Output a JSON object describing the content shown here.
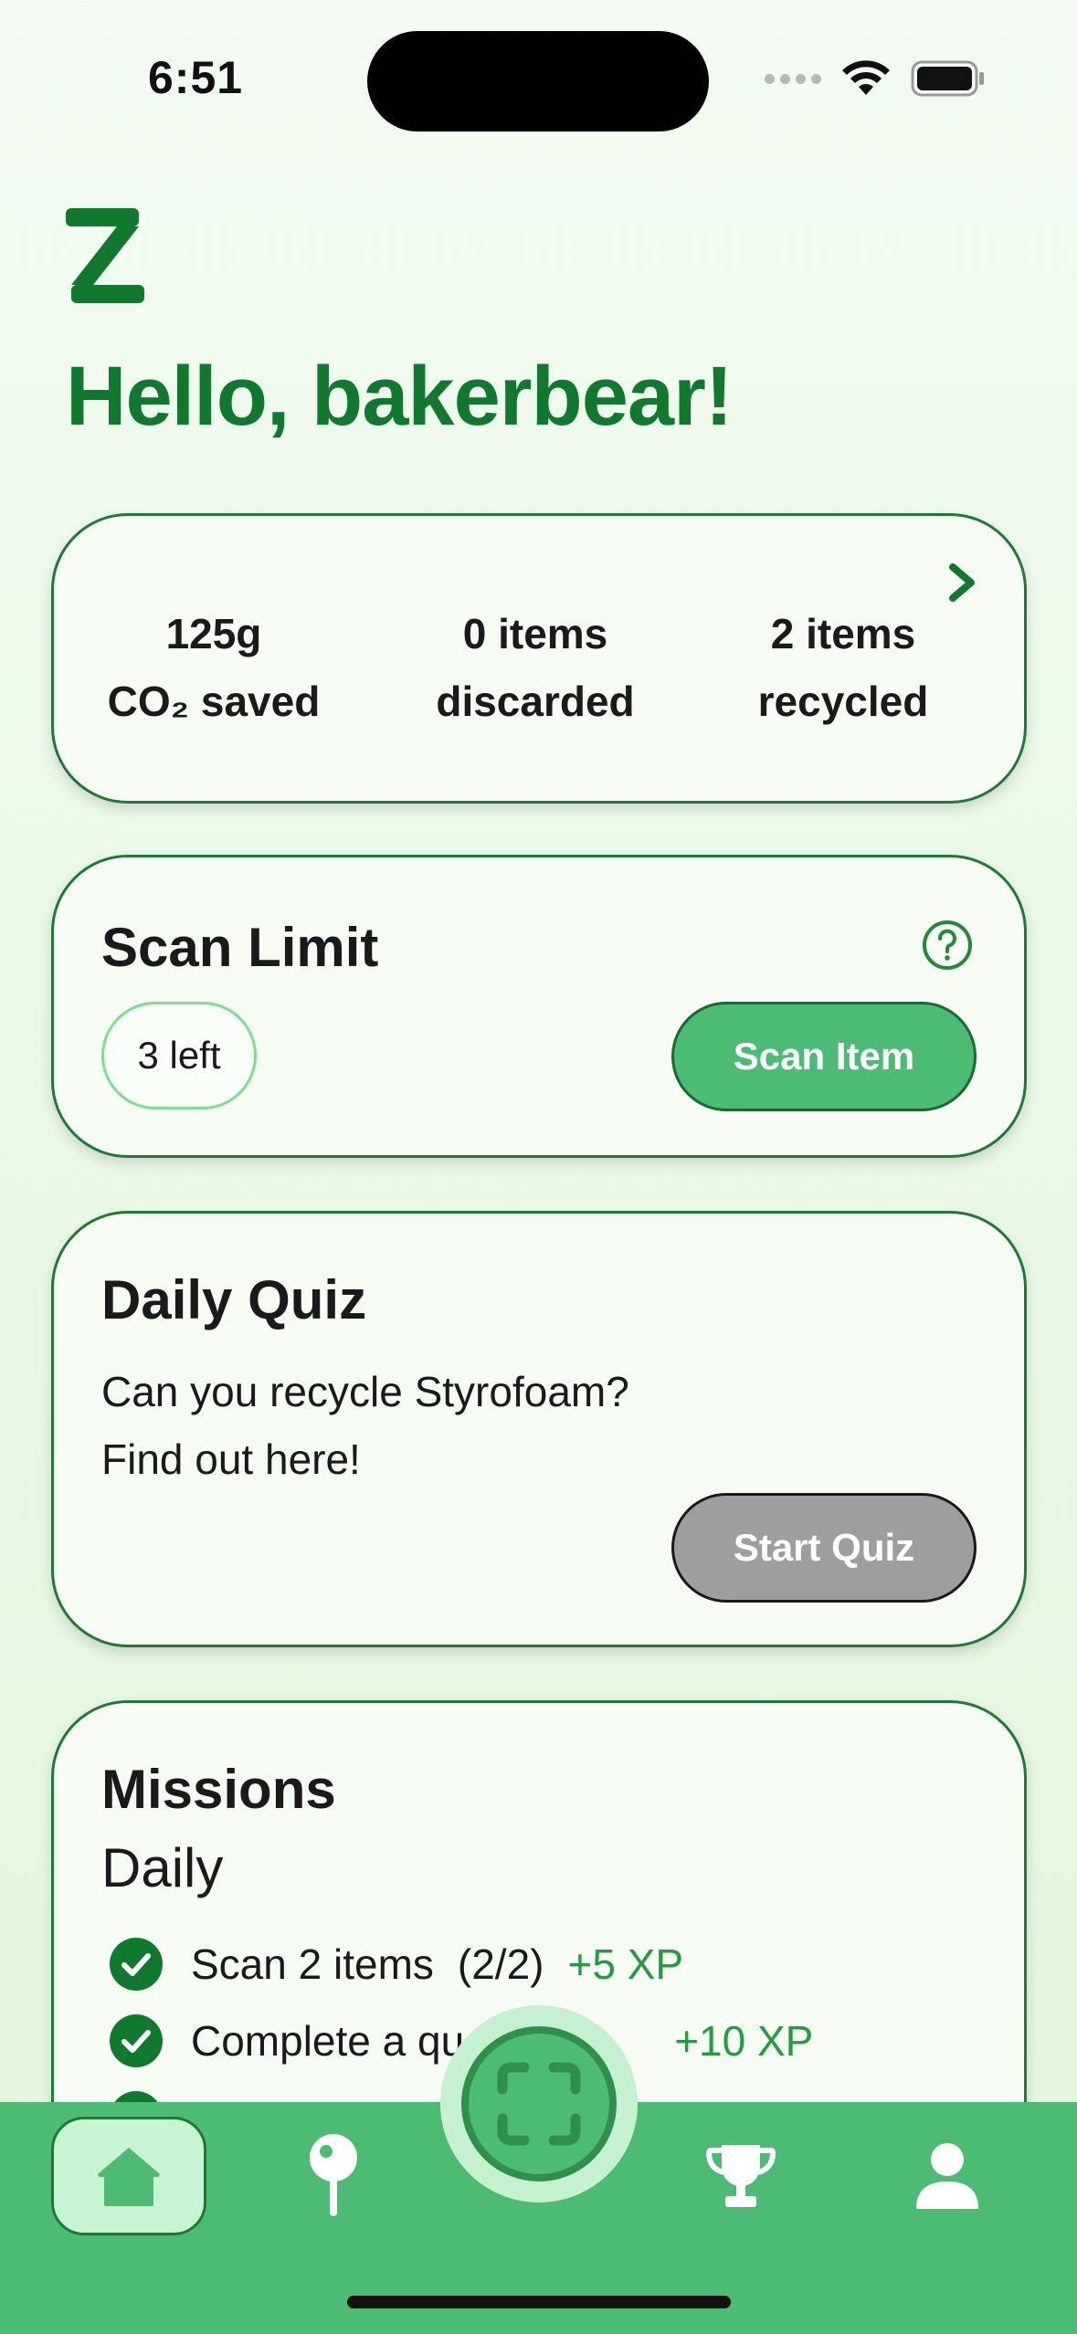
{
  "status_bar": {
    "time": "6:51"
  },
  "greeting": "Hello, bakerbear!",
  "stats": {
    "items": [
      {
        "line1": "125g",
        "line2": "CO₂ saved"
      },
      {
        "line1": "0 items",
        "line2": "discarded"
      },
      {
        "line1": "2 items",
        "line2": "recycled"
      }
    ]
  },
  "scan_limit": {
    "title": "Scan Limit",
    "remaining": "3 left",
    "button": "Scan Item"
  },
  "daily_quiz": {
    "title": "Daily Quiz",
    "line1": "Can you recycle Styrofoam?",
    "line2": "Find out here!",
    "button": "Start Quiz"
  },
  "missions": {
    "title": "Missions",
    "subtitle": "Daily",
    "items": [
      {
        "label": "Scan 2 items",
        "progress": "(2/2)",
        "xp": "+5 XP"
      },
      {
        "label": "Complete a qu",
        "progress": "",
        "xp": "+10 XP"
      }
    ]
  },
  "colors": {
    "brand_green": "#0f7a2e",
    "button_green": "#4cbb74",
    "disabled_gray": "#9d9e9d"
  },
  "tabbar": {
    "tabs": [
      "home-icon",
      "map-pin-icon",
      "scan-icon",
      "trophy-icon",
      "profile-icon"
    ],
    "active": "home-icon"
  }
}
